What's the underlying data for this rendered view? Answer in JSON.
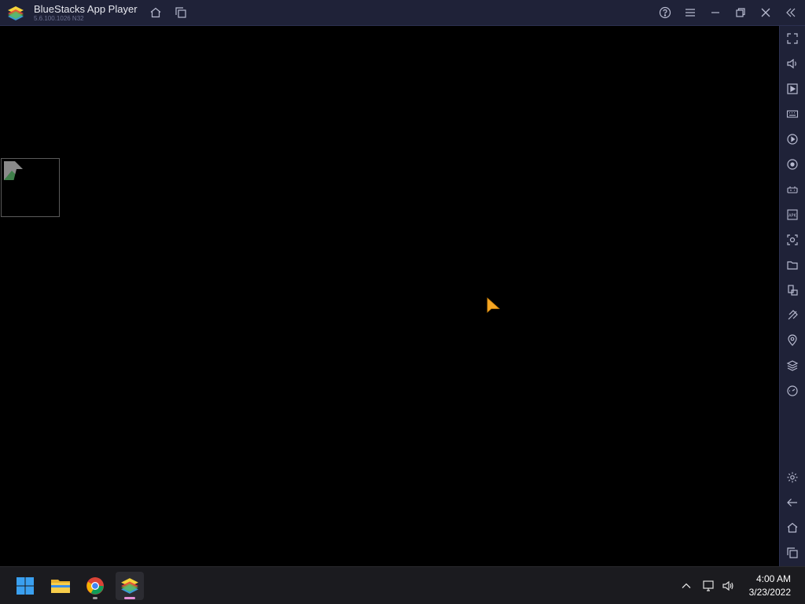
{
  "window": {
    "title": "BlueStacks App Player",
    "version": "5.6.100.1026 N32"
  },
  "titlebar_icons": [
    "home-icon",
    "multi-instance-icon",
    "help-icon",
    "menu-icon",
    "minimize-icon",
    "restore-icon",
    "close-icon",
    "collapse-sidebar-icon"
  ],
  "sidebar_icons": [
    "fullscreen-icon",
    "volume-icon",
    "media-manager-icon",
    "keyboard-icon",
    "macro-icon",
    "rotate-icon",
    "gamepad-icon",
    "install-apk-icon",
    "screenshot-icon",
    "folder-icon",
    "multi-instance-icon",
    "eco-mode-icon",
    "location-icon",
    "layers-icon",
    "performance-icon",
    "settings-icon",
    "back-icon",
    "home-icon",
    "recent-apps-icon"
  ],
  "taskbar": {
    "apps": [
      "windows-start-icon",
      "file-explorer-icon",
      "chrome-icon",
      "bluestacks-icon"
    ],
    "tray": [
      "chevron-up-icon",
      "network-icon",
      "volume-icon"
    ],
    "time": "4:00 AM",
    "date": "3/23/2022"
  },
  "colors": {
    "chrome_bg": "#1f2238",
    "accent": "#f5a623",
    "taskbar_bg": "#1b1b1f"
  }
}
